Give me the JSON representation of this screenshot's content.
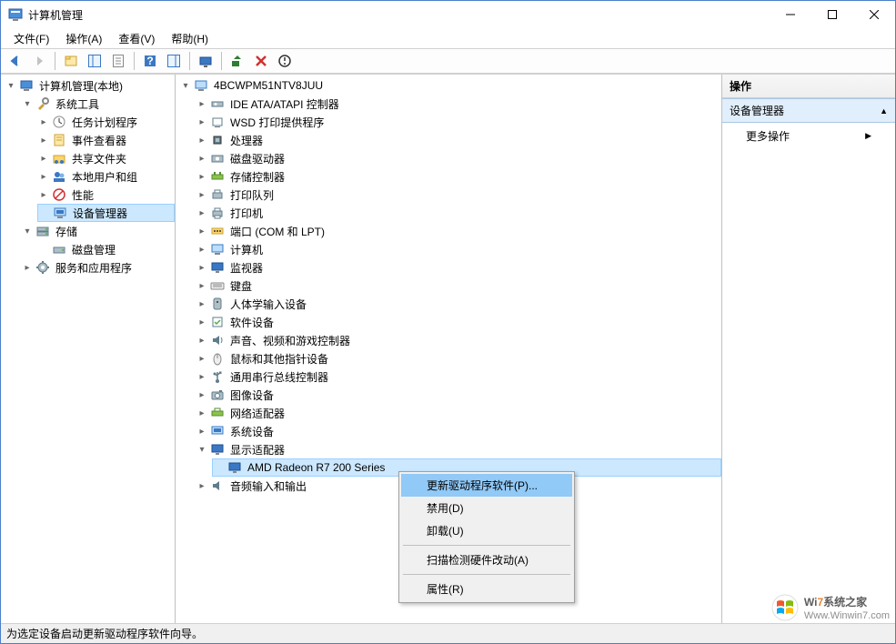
{
  "window": {
    "title": "计算机管理",
    "min_tip": "最小化",
    "max_tip": "最大化",
    "close_tip": "关闭"
  },
  "menubar": {
    "file": "文件(F)",
    "action": "操作(A)",
    "view": "查看(V)",
    "help": "帮助(H)"
  },
  "left_tree": {
    "root": "计算机管理(本地)",
    "system_tools": "系统工具",
    "task_scheduler": "任务计划程序",
    "event_viewer": "事件查看器",
    "shared_folders": "共享文件夹",
    "local_users": "本地用户和组",
    "performance": "性能",
    "device_manager": "设备管理器",
    "storage": "存储",
    "disk_mgmt": "磁盘管理",
    "services_apps": "服务和应用程序"
  },
  "devtree": {
    "root": "4BCWPM51NTV8JUU",
    "ide": "IDE ATA/ATAPI 控制器",
    "wsd": "WSD 打印提供程序",
    "cpu": "处理器",
    "disk": "磁盘驱动器",
    "storage_ctrl": "存储控制器",
    "print_queue": "打印队列",
    "printer": "打印机",
    "ports": "端口 (COM 和 LPT)",
    "computer": "计算机",
    "monitor": "监视器",
    "keyboard": "键盘",
    "hid": "人体学输入设备",
    "software_dev": "软件设备",
    "sound": "声音、视频和游戏控制器",
    "mouse": "鼠标和其他指针设备",
    "usb": "通用串行总线控制器",
    "image_dev": "图像设备",
    "network": "网络适配器",
    "system_dev": "系统设备",
    "display": "显示适配器",
    "display_item": "AMD Radeon R7 200 Series",
    "audio_io": "音频输入和输出"
  },
  "context_menu": {
    "update": "更新驱动程序软件(P)...",
    "disable": "禁用(D)",
    "uninstall": "卸载(U)",
    "scan": "扫描检测硬件改动(A)",
    "properties": "属性(R)"
  },
  "actions_pane": {
    "header": "操作",
    "section": "设备管理器",
    "more": "更多操作"
  },
  "statusbar": "为选定设备启动更新驱动程序软件向导。",
  "watermark": {
    "brand_pre": "Wi",
    "brand_seven": "7",
    "brand_post": "系统之家",
    "url": "Www.Winwin7.com"
  }
}
